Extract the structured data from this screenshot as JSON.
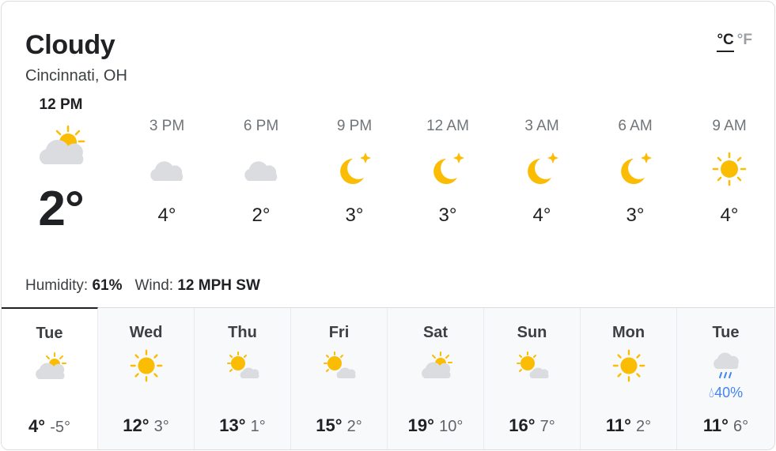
{
  "header": {
    "condition": "Cloudy",
    "location": "Cincinnati, OH",
    "unit_c": "°C",
    "unit_f": "°F"
  },
  "current": {
    "time": "12 PM",
    "temp": "2°",
    "icon": "partly-cloudy-icon"
  },
  "hourly": [
    {
      "time": "3 PM",
      "temp": "4°",
      "icon": "cloud-icon"
    },
    {
      "time": "6 PM",
      "temp": "2°",
      "icon": "cloud-icon"
    },
    {
      "time": "9 PM",
      "temp": "3°",
      "icon": "moon-icon"
    },
    {
      "time": "12 AM",
      "temp": "3°",
      "icon": "moon-icon"
    },
    {
      "time": "3 AM",
      "temp": "4°",
      "icon": "moon-icon"
    },
    {
      "time": "6 AM",
      "temp": "3°",
      "icon": "moon-icon"
    },
    {
      "time": "9 AM",
      "temp": "4°",
      "icon": "sun-icon"
    }
  ],
  "details": {
    "humidity_label": "Humidity:",
    "humidity_value": "61%",
    "wind_label": "Wind:",
    "wind_value": "12 MPH SW"
  },
  "daily": [
    {
      "day": "Tue",
      "hi": "4°",
      "lo": "-5°",
      "icon": "partly-cloudy-icon",
      "precip": ""
    },
    {
      "day": "Wed",
      "hi": "12°",
      "lo": "3°",
      "icon": "sun-icon",
      "precip": ""
    },
    {
      "day": "Thu",
      "hi": "13°",
      "lo": "1°",
      "icon": "mostly-sunny-icon",
      "precip": ""
    },
    {
      "day": "Fri",
      "hi": "15°",
      "lo": "2°",
      "icon": "mostly-sunny-icon",
      "precip": ""
    },
    {
      "day": "Sat",
      "hi": "19°",
      "lo": "10°",
      "icon": "partly-cloudy-icon",
      "precip": ""
    },
    {
      "day": "Sun",
      "hi": "16°",
      "lo": "7°",
      "icon": "mostly-sunny-icon",
      "precip": ""
    },
    {
      "day": "Mon",
      "hi": "11°",
      "lo": "2°",
      "icon": "sun-icon",
      "precip": ""
    },
    {
      "day": "Tue",
      "hi": "11°",
      "lo": "6°",
      "icon": "rain-icon",
      "precip": "40%"
    }
  ],
  "colors": {
    "sun": "#fbbc04",
    "cloud": "#dadce0",
    "rain": "#4285f4"
  }
}
